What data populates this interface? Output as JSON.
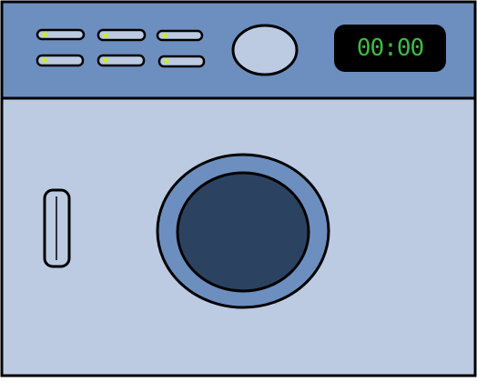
{
  "colors": {
    "panel": "#6d8fbf",
    "body": "#bccbe2",
    "outline": "#000000",
    "knob": "#bccbe2",
    "indicator": "#c8f01e",
    "screen_bg": "#000000",
    "screen_text": "#3dbb45",
    "door_ring": "#6d8fbf",
    "door_glass": "#2c4261"
  },
  "display": {
    "time": "00:00"
  },
  "controls": {
    "buttons": [
      {
        "row": 0,
        "col": 0,
        "icon": "program-button-icon"
      },
      {
        "row": 0,
        "col": 1,
        "icon": "program-button-icon"
      },
      {
        "row": 0,
        "col": 2,
        "icon": "program-button-icon"
      },
      {
        "row": 1,
        "col": 0,
        "icon": "program-button-icon"
      },
      {
        "row": 1,
        "col": 1,
        "icon": "program-button-icon"
      },
      {
        "row": 1,
        "col": 2,
        "icon": "program-button-icon"
      }
    ],
    "knob_icon": "dial-knob-icon",
    "handle_icon": "door-handle-icon",
    "door_icon": "drum-door-icon"
  }
}
